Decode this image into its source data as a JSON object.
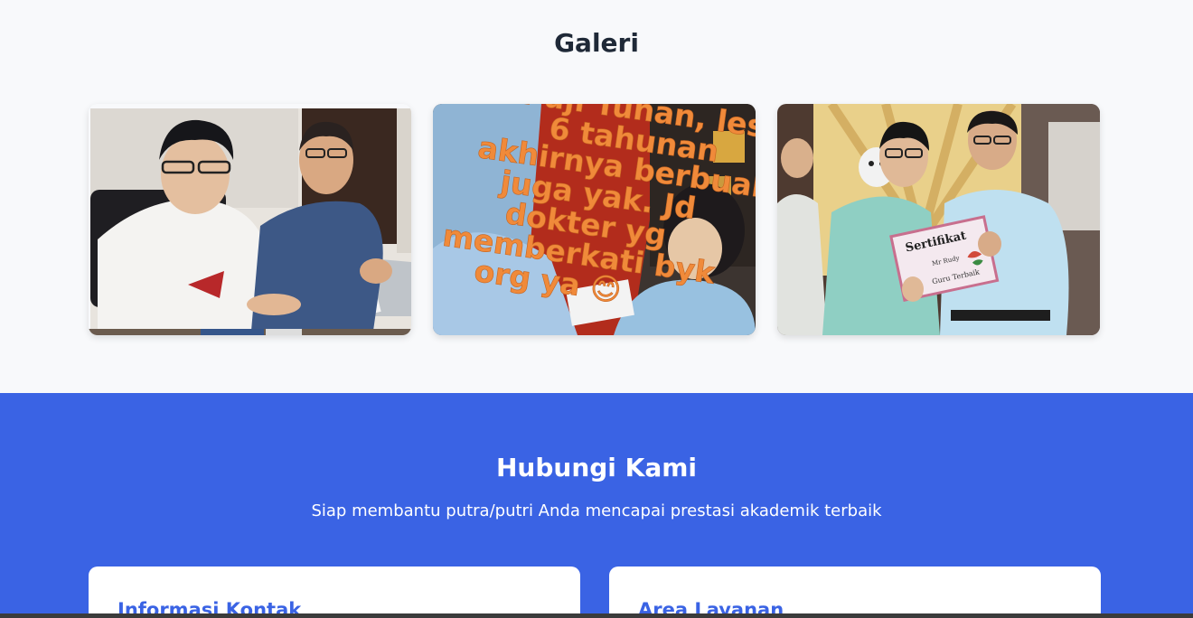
{
  "gallery": {
    "title": "Galeri",
    "photos": [
      {
        "alt": "Siswa dan guru belajar di meja"
      },
      {
        "alt": "Siswi belajar dengan teks testimoni",
        "overlay_text": [
          "Puji Tuhan, les",
          "6 tahunan",
          "akhirnya berbuah",
          "juga yak. Jd",
          "dokter yg",
          "memberkati byk",
          "org ya 😊"
        ]
      },
      {
        "alt": "Penyerahan sertifikat guru terbaik",
        "certificate": {
          "title": "Sertifikat",
          "name": "Mr Rudy",
          "caption": "Guru Terbaik"
        }
      }
    ]
  },
  "contact": {
    "title": "Hubungi Kami",
    "subtitle": "Siap membantu putra/putri Anda mencapai prestasi akademik terbaik",
    "cards": [
      {
        "title": "Informasi Kontak"
      },
      {
        "title": "Area Layanan"
      }
    ]
  }
}
